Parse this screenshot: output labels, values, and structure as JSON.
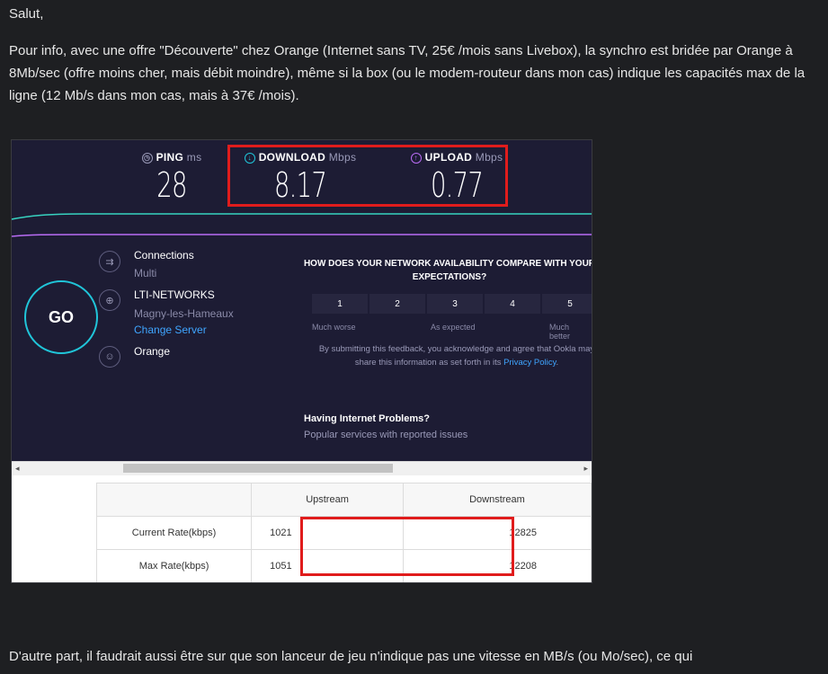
{
  "post": {
    "greeting": "Salut,",
    "paragraph": "Pour info, avec une offre \"Découverte\" chez Orange (Internet sans TV, 25€ /mois sans Livebox), la synchro est bridée par Orange à 8Mb/sec (offre moins cher, mais débit moindre), même si la box (ou le modem-routeur dans mon cas) indique les capacités max de la ligne (12 Mb/s dans mon cas, mais à 37€ /mois).",
    "next_paragraph": "D'autre part, il faudrait aussi être sur que son lanceur de jeu n'indique pas une vitesse en MB/s (ou Mo/sec), ce qui"
  },
  "speedtest": {
    "ping": {
      "label": "PING",
      "unit": "ms",
      "value": "28"
    },
    "download": {
      "label": "DOWNLOAD",
      "unit": "Mbps",
      "value": "8.17"
    },
    "upload": {
      "label": "UPLOAD",
      "unit": "Mbps",
      "value": "0.77"
    },
    "go_label": "GO",
    "connections_label": "Connections",
    "connections_value": "Multi",
    "server_name": "LTI-NETWORKS",
    "server_location": "Magny-les-Hameaux",
    "change_server": "Change Server",
    "isp": "Orange",
    "question": "HOW DOES YOUR NETWORK AVAILABILITY COMPARE WITH YOUR EXPECTATIONS?",
    "scale": [
      "1",
      "2",
      "3",
      "4",
      "5"
    ],
    "scale_low": "Much worse",
    "scale_mid": "As expected",
    "scale_high": "Much better",
    "disclaimer_1": "By submitting this feedback, you acknowledge and agree that Ookla may share this information as set forth in its",
    "disclaimer_link": "Privacy Policy",
    "disclaimer_end": ".",
    "problems_title": "Having Internet Problems?",
    "problems_sub": "Popular services with reported issues",
    "colors": {
      "bg": "#1d1c34",
      "accent": "#20c5d9",
      "upload": "#b96cf5",
      "link": "#3fa5ff",
      "highlight": "#e01c1c"
    }
  },
  "router": {
    "headers": [
      "",
      "Upstream",
      "Downstream"
    ],
    "rows": [
      {
        "label": "Current Rate(kbps)",
        "up": "1021",
        "down": "12825"
      },
      {
        "label": "Max Rate(kbps)",
        "up": "1051",
        "down": "12208"
      }
    ]
  }
}
